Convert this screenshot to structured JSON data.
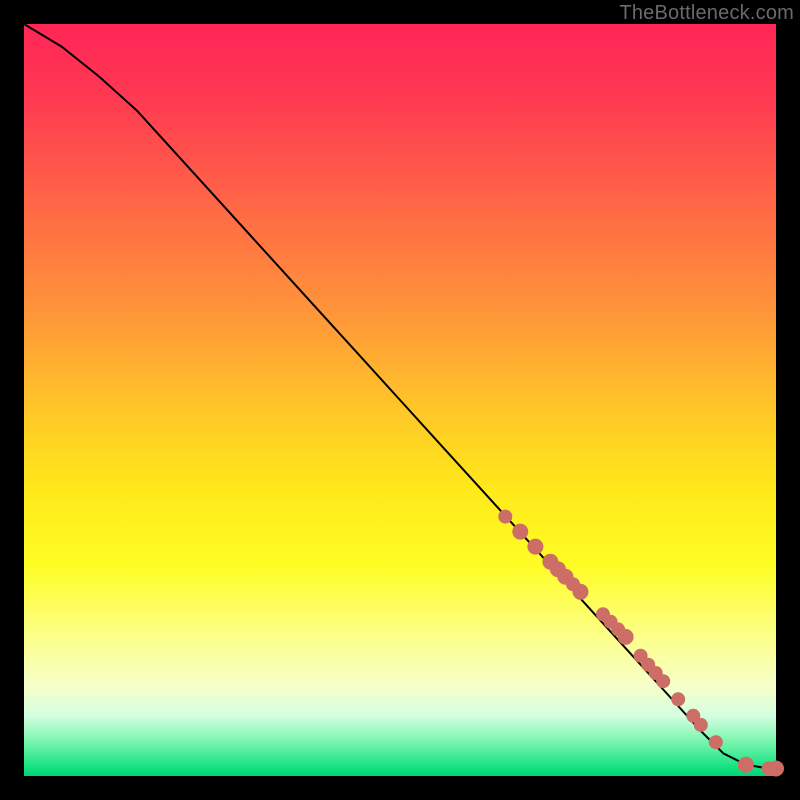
{
  "watermark": "TheBottleneck.com",
  "colors": {
    "background": "#000000",
    "curve": "#000000",
    "dot": "#cc6d66",
    "gradient_top": "#ff2556",
    "gradient_mid": "#ffe91a",
    "gradient_bottom": "#06d176"
  },
  "chart_data": {
    "type": "line",
    "title": "",
    "xlabel": "",
    "ylabel": "",
    "xlim": [
      0,
      100
    ],
    "ylim": [
      0,
      100
    ],
    "curve": {
      "name": "bottleneck-curve",
      "x": [
        0,
        5,
        10,
        15,
        20,
        25,
        30,
        35,
        40,
        45,
        50,
        55,
        60,
        65,
        70,
        75,
        80,
        85,
        90,
        93,
        96,
        99,
        100
      ],
      "y": [
        100,
        97,
        93,
        88.5,
        83,
        77.5,
        72,
        66.5,
        61,
        55.5,
        50,
        44.5,
        39,
        33.5,
        28,
        22.5,
        17,
        11.5,
        6,
        3,
        1.5,
        1,
        1
      ]
    },
    "markers": {
      "name": "highlighted-points",
      "x": [
        64,
        66,
        68,
        70,
        71,
        72,
        73,
        74,
        77,
        78,
        79,
        80,
        82,
        83,
        84,
        85,
        87,
        89,
        90,
        92,
        96,
        99,
        100
      ],
      "y": [
        34.5,
        32.5,
        30.5,
        28.5,
        27.5,
        26.5,
        25.5,
        24.5,
        21.5,
        20.5,
        19.5,
        18.5,
        16,
        14.8,
        13.7,
        12.6,
        10.2,
        8,
        6.8,
        4.5,
        1.5,
        1,
        1
      ],
      "r": [
        7,
        8,
        8,
        8,
        8,
        8,
        7,
        8,
        7,
        7,
        7,
        8,
        7,
        7,
        7,
        7,
        7,
        7,
        7,
        7,
        8,
        7,
        8
      ]
    }
  }
}
